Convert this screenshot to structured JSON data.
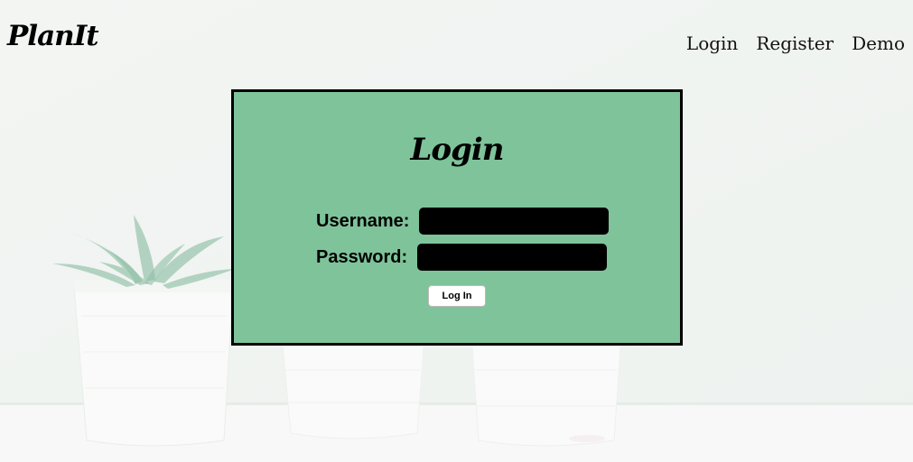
{
  "brand": {
    "logo_text": "PlanIt"
  },
  "nav": {
    "items": [
      {
        "label": "Login"
      },
      {
        "label": "Register"
      },
      {
        "label": "Demo"
      }
    ]
  },
  "login_form": {
    "title": "Login",
    "username_label": "Username:",
    "password_label": "Password:",
    "username_value": "",
    "password_value": "",
    "submit_label": "Log In"
  },
  "colors": {
    "background": "#f1f4f1",
    "form_background": "#7fc39a",
    "form_border": "#000000",
    "input_fill": "#000000",
    "button_fill": "#ffffff"
  }
}
